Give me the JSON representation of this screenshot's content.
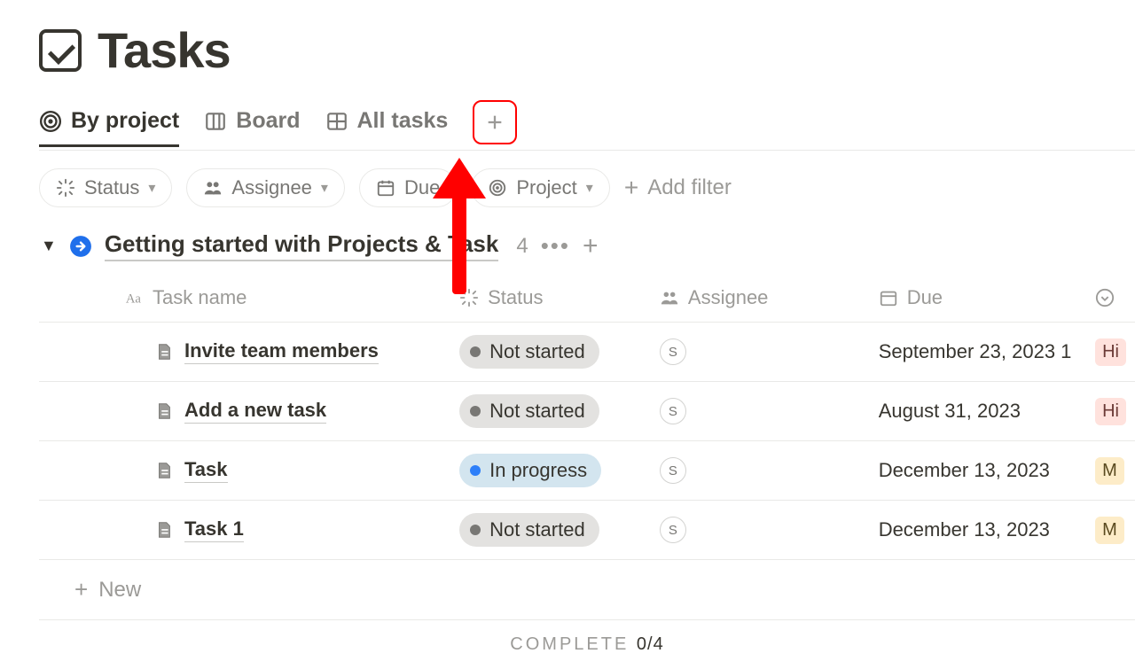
{
  "page": {
    "title": "Tasks"
  },
  "tabs": {
    "by_project": "By project",
    "board": "Board",
    "all_tasks": "All tasks"
  },
  "filters": {
    "status": "Status",
    "assignee": "Assignee",
    "due": "Due",
    "project": "Project",
    "add": "Add filter"
  },
  "group": {
    "title": "Getting started with Projects & Task",
    "count": "4"
  },
  "columns": {
    "name": "Task name",
    "status": "Status",
    "assignee": "Assignee",
    "due": "Due"
  },
  "rows": [
    {
      "name": "Invite team members",
      "status": "Not started",
      "status_kind": "notstarted",
      "assignee": "S",
      "due": "September 23, 2023 1",
      "priority": "Hi",
      "priority_kind": "hi"
    },
    {
      "name": "Add a new task",
      "status": "Not started",
      "status_kind": "notstarted",
      "assignee": "S",
      "due": "August 31, 2023",
      "priority": "Hi",
      "priority_kind": "hi"
    },
    {
      "name": "Task",
      "status": "In progress",
      "status_kind": "inprogress",
      "assignee": "S",
      "due": "December 13, 2023",
      "priority": "M",
      "priority_kind": "m"
    },
    {
      "name": "Task 1",
      "status": "Not started",
      "status_kind": "notstarted",
      "assignee": "S",
      "due": "December 13, 2023",
      "priority": "M",
      "priority_kind": "m"
    }
  ],
  "new_row": "New",
  "footer": {
    "label": "COMPLETE",
    "value": "0/4"
  }
}
